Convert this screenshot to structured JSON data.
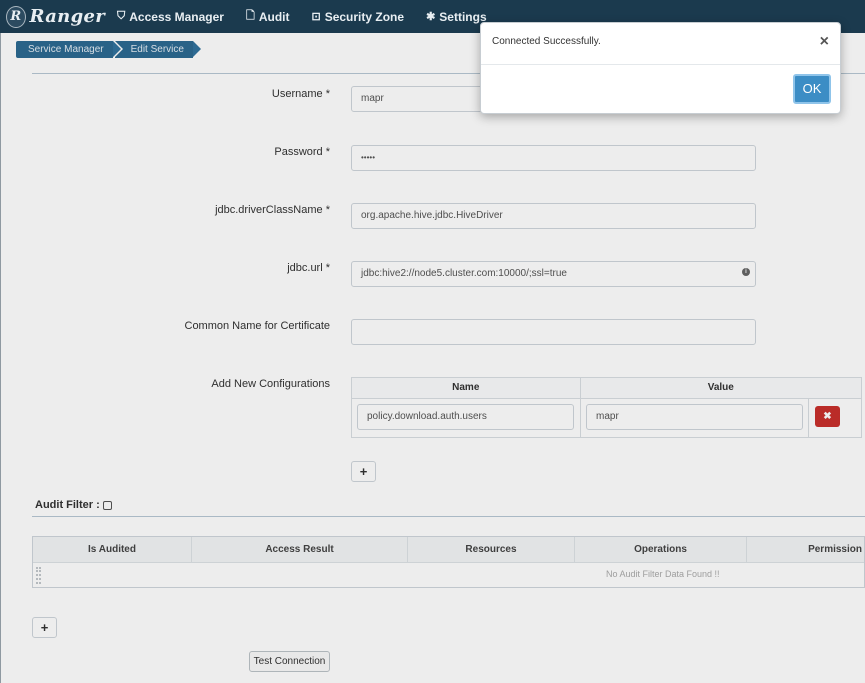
{
  "nav": {
    "brand": "Ranger",
    "brand_logo": "R",
    "items": [
      {
        "label": "Access Manager",
        "icon": "shield-icon",
        "glyph": "⛉"
      },
      {
        "label": "Audit",
        "icon": "file-icon",
        "glyph": "🗋"
      },
      {
        "label": "Security Zone",
        "icon": "zone-icon",
        "glyph": "⊡"
      },
      {
        "label": "Settings",
        "icon": "gear-icon",
        "glyph": "✱"
      }
    ]
  },
  "breadcrumb": [
    "Service Manager",
    "Edit Service"
  ],
  "form": {
    "username_label": "Username *",
    "username_value": "mapr",
    "password_label": "Password *",
    "password_value": "•••••",
    "driver_label": "jdbc.driverClassName *",
    "driver_value": "org.apache.hive.jdbc.HiveDriver",
    "url_label": "jdbc.url *",
    "url_value": "jdbc:hive2://node5.cluster.com:10000/;ssl=true",
    "cn_label": "Common Name for Certificate",
    "cn_value": "",
    "config_label": "Add New Configurations"
  },
  "config_table": {
    "headers": [
      "Name",
      "Value"
    ],
    "rows": [
      {
        "name": "policy.download.auth.users",
        "value": "mapr"
      }
    ],
    "delete_glyph": "✖",
    "add_glyph": "+"
  },
  "audit": {
    "label": "Audit Filter :",
    "headers": [
      "Is Audited",
      "Access Result",
      "Resources",
      "Operations",
      "Permission"
    ],
    "empty_text": "No Audit Filter Data Found !!",
    "add_glyph": "+"
  },
  "test_connection_label": "Test Connection",
  "modal": {
    "message": "Connected Successfully.",
    "close_glyph": "×",
    "ok_label": "OK"
  },
  "colors": {
    "navbar": "#1b3a4e",
    "breadcrumb": "#2d6a92",
    "ok_button": "#3c8dc5",
    "delete_button": "#c9302c"
  }
}
